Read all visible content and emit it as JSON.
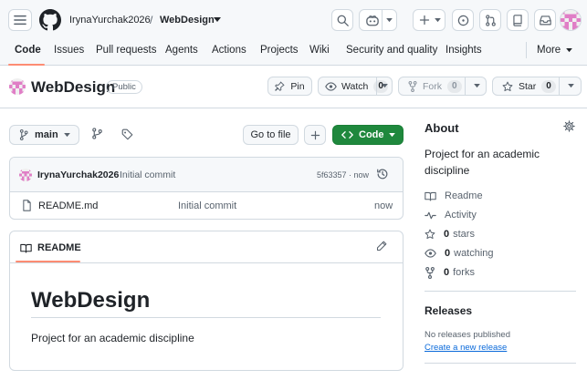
{
  "header": {
    "owner": "IrynaYurchak2026",
    "separator": "/",
    "repo": "WebDesign"
  },
  "tabs": [
    "Code",
    "Issues",
    "Pull requests",
    "Agents",
    "Actions",
    "Projects",
    "Wiki",
    "Security and quality",
    "Insights"
  ],
  "more_label": "More",
  "repo_header": {
    "name": "WebDesign",
    "visibility": "Public",
    "pin_label": "Pin",
    "watch_label": "Watch",
    "watch_count": "0",
    "fork_label": "Fork",
    "fork_count": "0",
    "star_label": "Star",
    "star_count": "0"
  },
  "toolbar": {
    "branch": "main",
    "go_to_file": "Go to file",
    "code_label": "Code"
  },
  "commit": {
    "author": "IrynaYurchak2026",
    "message": "Initial commit",
    "hash_time": "5f63357 · now"
  },
  "files": [
    {
      "name": "README.md",
      "message": "Initial commit",
      "time": "now"
    }
  ],
  "readme": {
    "tab_label": "README",
    "heading": "WebDesign",
    "body": "Project for an academic discipline"
  },
  "about": {
    "title": "About",
    "description": "Project for an academic discipline",
    "readme": "Readme",
    "activity": "Activity",
    "stars_count": "0",
    "stars_label": "stars",
    "watching_count": "0",
    "watching_label": "watching",
    "forks_count": "0",
    "forks_label": "forks"
  },
  "releases": {
    "title": "Releases",
    "none": "No releases published",
    "create_link": "Create a new release"
  },
  "colors": {
    "accent_orange": "#fd8c73",
    "code_green": "#1f883d",
    "link_blue": "#0969da"
  }
}
